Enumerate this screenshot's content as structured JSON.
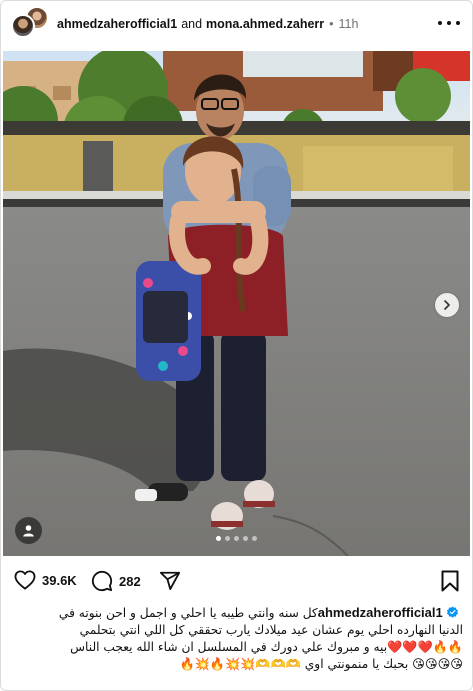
{
  "header": {
    "user1": "ahmedzaherofficial1",
    "conjunction": "and",
    "user2": "mona.ahmed.zaherr",
    "separator": "•",
    "time": "11h",
    "more_icon": "more-horizontal-icon"
  },
  "post": {
    "carousel": {
      "slide_count": 5,
      "active_index": 0
    }
  },
  "actions": {
    "like_count": "39.6K",
    "comment_count": "282",
    "like_icon": "heart-icon",
    "comment_icon": "comment-bubble-icon",
    "share_icon": "paper-plane-icon",
    "save_icon": "bookmark-icon"
  },
  "caption": {
    "username": "ahmedzaherofficial1",
    "line1": "كل سنه وانتي طيبه يا احلي و اجمل و احن بنوته في",
    "line2": "الدنيا النهارده احلي يوم عشان عيد ميلادك يارب تحققي كل اللي انتي بتحلمي",
    "line3": "🔥🔥❤️❤️❤️بيه و مبروك علي دورك في المسلسل ان شاء الله يعجب الناس",
    "line4": "😘😘😘😘 بحبك يا منمونتي اوي 🫶🫶🫶💥💥🔥💥🔥"
  },
  "colors": {
    "accent": "#0095f6",
    "text": "#111111",
    "muted": "#737373"
  }
}
